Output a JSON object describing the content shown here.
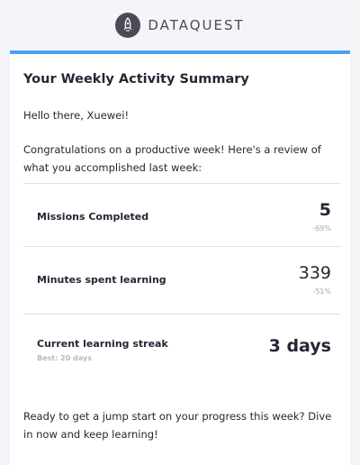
{
  "brand": {
    "name": "DATAQUEST",
    "logo_icon": "rocket-icon"
  },
  "accent": "#4da1f2",
  "title": "Your Weekly Activity Summary",
  "greeting": "Hello there, Xuewei!",
  "intro": "Congratulations on a productive week! Here's a review of what you accomplished last week:",
  "stats": [
    {
      "label": "Missions Completed",
      "value": "5",
      "change": "-69%"
    },
    {
      "label": "Minutes spent learning",
      "value": "339",
      "change": "-51%"
    },
    {
      "label": "Current learning streak",
      "value": "3 days",
      "sub": "Best: 20 days"
    }
  ],
  "outro": "Ready to get a jump start on your progress this week? Dive in now and keep learning!"
}
